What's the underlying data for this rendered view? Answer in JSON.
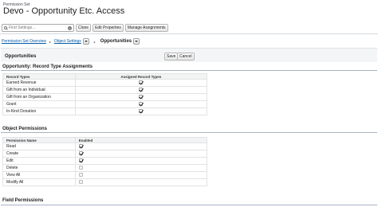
{
  "header": {
    "eyebrow": "Permission Set",
    "title": "Devo - Opportunity Etc. Access"
  },
  "toolbar": {
    "search_placeholder": "Find Settings...",
    "buttons": [
      "Clone",
      "Edit Properties",
      "Manage Assignments"
    ]
  },
  "breadcrumb": {
    "overview": "Permission Set Overview",
    "settings": "Object Settings",
    "current": "Opportunities"
  },
  "detail": {
    "title": "Opportunities",
    "save_label": "Save",
    "cancel_label": "Cancel"
  },
  "record_types": {
    "section_title": "Opportunity: Record Type Assignments",
    "columns": [
      "Record Types",
      "Assigned Record Types"
    ],
    "rows": [
      {
        "name": "Earned Revenue",
        "assigned": true
      },
      {
        "name": "Gift from an Individual",
        "assigned": true
      },
      {
        "name": "Gift from an Organization",
        "assigned": true
      },
      {
        "name": "Grant",
        "assigned": true
      },
      {
        "name": "In-Kind Donation",
        "assigned": true
      }
    ]
  },
  "object_permissions": {
    "section_title": "Object Permissions",
    "columns": [
      "Permission Name",
      "Enabled"
    ],
    "rows": [
      {
        "name": "Read",
        "enabled": true
      },
      {
        "name": "Create",
        "enabled": true
      },
      {
        "name": "Edit",
        "enabled": true
      },
      {
        "name": "Delete",
        "enabled": false
      },
      {
        "name": "View All",
        "enabled": false
      },
      {
        "name": "Modify All",
        "enabled": false
      }
    ]
  },
  "field_permissions": {
    "section_title": "Field Permissions"
  }
}
